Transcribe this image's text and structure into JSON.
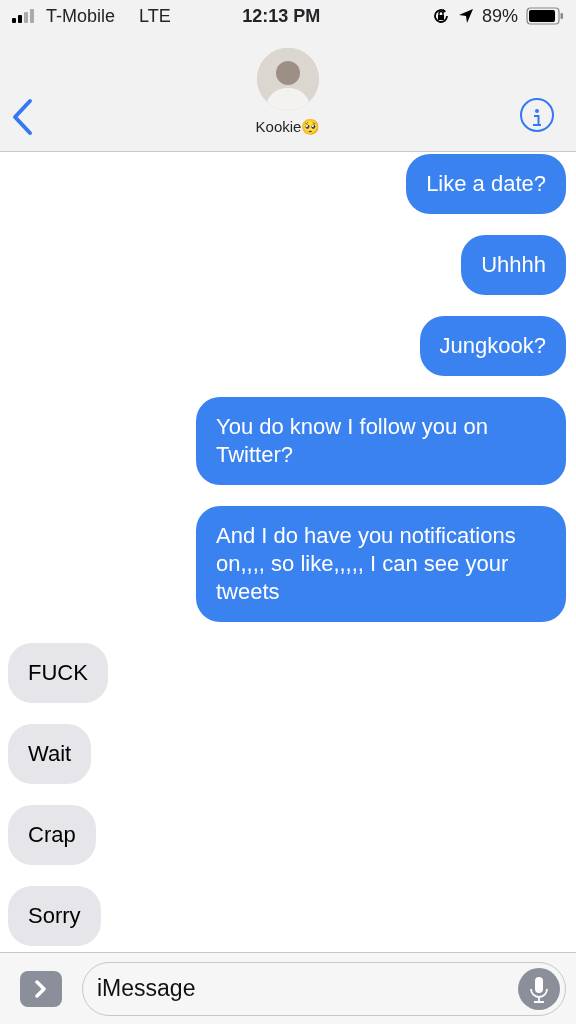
{
  "status_bar": {
    "carrier": "T-Mobile",
    "network": "LTE",
    "time": "12:13 PM",
    "battery": "89%"
  },
  "header": {
    "contact_name": "Kookie🥺"
  },
  "messages": [
    {
      "text": "Like a date?",
      "kind": "sent"
    },
    {
      "text": "Uhhhh",
      "kind": "sent"
    },
    {
      "text": "Jungkook?",
      "kind": "sent"
    },
    {
      "text": "You do know I follow you on Twitter?",
      "kind": "sent"
    },
    {
      "text": "And I do have you notifications on,,,, so like,,,,, I can see your tweets",
      "kind": "sent"
    },
    {
      "text": "FUCK",
      "kind": "received"
    },
    {
      "text": "Wait",
      "kind": "received"
    },
    {
      "text": "Crap",
      "kind": "received"
    },
    {
      "text": "Sorry",
      "kind": "received"
    }
  ],
  "composer": {
    "placeholder": "iMessage"
  }
}
